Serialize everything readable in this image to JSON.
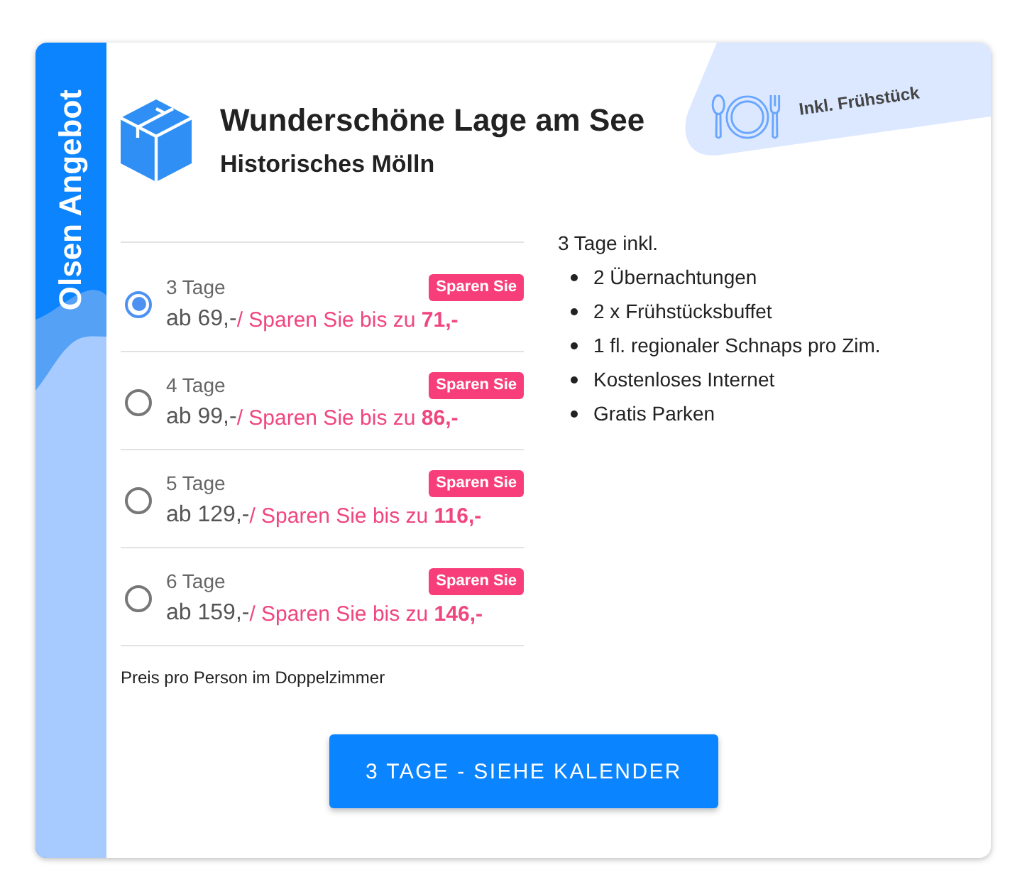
{
  "sidebar": {
    "label": "Olsen Angebot"
  },
  "ribbon": {
    "label": "Inkl. Frühstück"
  },
  "header": {
    "title": "Wunderschöne Lage am See",
    "subtitle": "Historisches Mölln"
  },
  "options": [
    {
      "duration": "3 Tage",
      "badge": "Sparen Sie",
      "price": "ab 69,-",
      "savings": "/ Sparen Sie bis zu **71,-**",
      "selected": true
    },
    {
      "duration": "4 Tage",
      "badge": "Sparen Sie",
      "price": "ab 99,-",
      "savings": "/ Sparen Sie bis zu **86,-**",
      "selected": false
    },
    {
      "duration": "5 Tage",
      "badge": "Sparen Sie",
      "price": "ab 129,-",
      "savings": "/ Sparen Sie bis zu **116,-**",
      "selected": false
    },
    {
      "duration": "6 Tage",
      "badge": "Sparen Sie",
      "price": "ab 159,-",
      "savings": "/ Sparen Sie bis zu **146,-**",
      "selected": false
    }
  ],
  "note": "Preis pro Person im Doppelzimmer",
  "inclusions": {
    "heading": "3 Tage inkl.",
    "items": [
      "2 Übernachtungen",
      "2 x Frühstücksbuffet",
      "1 fl. regionaler Schnaps pro Zim.",
      "Kostenloses Internet",
      "Gratis Parken"
    ]
  },
  "button": {
    "label": "3 TAGE - SIEHE KALENDER"
  }
}
